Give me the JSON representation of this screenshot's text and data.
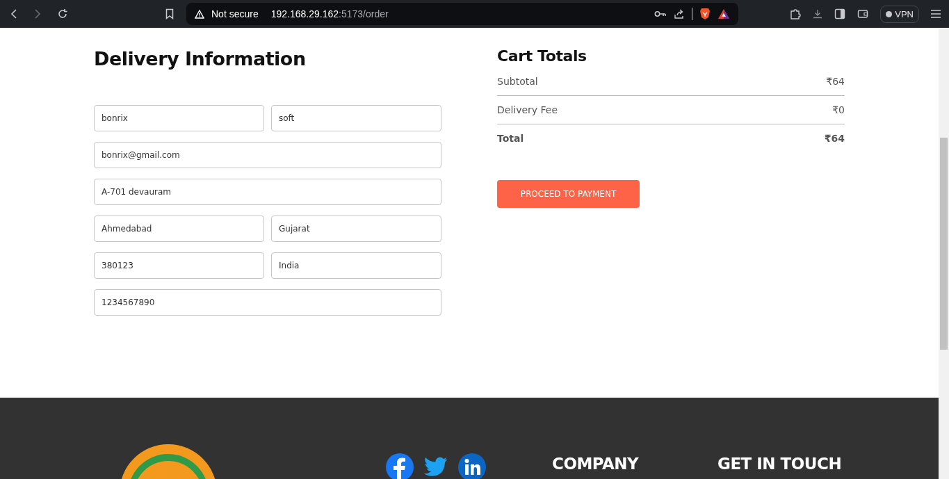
{
  "browser": {
    "security": "Not secure",
    "url_host": "192.168.29.162",
    "url_rest": ":5173/order",
    "vpn": "VPN"
  },
  "delivery": {
    "title": "Delivery Information",
    "rows": [
      {
        "fields": [
          {
            "value": "bonrix"
          },
          {
            "value": "soft"
          }
        ]
      },
      {
        "fields": [
          {
            "value": "bonrix@gmail.com"
          }
        ]
      },
      {
        "fields": [
          {
            "value": "A-701 devauram"
          }
        ]
      },
      {
        "fields": [
          {
            "value": "Ahmedabad"
          },
          {
            "value": "Gujarat"
          }
        ]
      },
      {
        "fields": [
          {
            "value": "380123"
          },
          {
            "value": "India"
          }
        ]
      },
      {
        "fields": [
          {
            "value": "1234567890"
          }
        ]
      }
    ]
  },
  "cart": {
    "title": "Cart Totals",
    "lines": [
      {
        "label": "Subtotal",
        "value": "₹64",
        "kind": "normal"
      },
      {
        "label": "Delivery Fee",
        "value": "₹0",
        "kind": "normal"
      },
      {
        "label": "Total",
        "value": "₹64",
        "kind": "total"
      }
    ],
    "button": "PROCEED TO PAYMENT"
  },
  "footer": {
    "headings": [
      "COMPANY",
      "GET IN TOUCH"
    ]
  }
}
